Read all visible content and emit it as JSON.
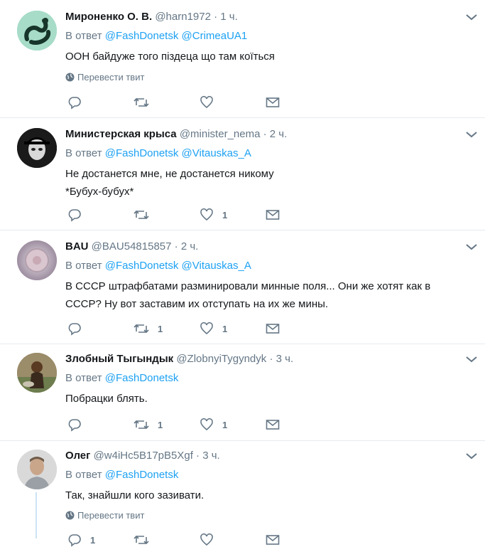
{
  "ui": {
    "reply_prefix": "В ответ",
    "translate_label": "Перевести твит"
  },
  "tweets": [
    {
      "name": "Мироненко О. В.",
      "handle": "@harn1972",
      "time": "1 ч.",
      "mentions": [
        "@FashDonetsk",
        "@CrimeaUA1"
      ],
      "lines": [
        "ООН байдуже того піздеца що там коїться"
      ],
      "replies": "",
      "retweets": "",
      "likes": ""
    },
    {
      "name": "Министерская крыса",
      "handle": "@minister_nema",
      "time": "2 ч.",
      "mentions": [
        "@FashDonetsk",
        "@Vitauskas_A"
      ],
      "lines": [
        "Не достанется мне, не достанется никому",
        "*Бубух-бубух*"
      ],
      "replies": "",
      "retweets": "",
      "likes": "1"
    },
    {
      "name": "BAU",
      "handle": "@BAU54815857",
      "time": "2 ч.",
      "mentions": [
        "@FashDonetsk",
        "@Vitauskas_A"
      ],
      "lines": [
        "В СССР штрафбатами разминировали минные поля... Они же хотят как в",
        "СССР? Ну вот заставим их отступать на их же мины."
      ],
      "replies": "",
      "retweets": "1",
      "likes": "1"
    },
    {
      "name": "Злобный Тыгындык",
      "handle": "@ZlobnyiTygyndyk",
      "time": "3 ч.",
      "mentions": [
        "@FashDonetsk"
      ],
      "lines": [
        "Побрацки блять."
      ],
      "replies": "",
      "retweets": "1",
      "likes": "1"
    },
    {
      "name": "Олег",
      "handle": "@w4iHc5B17pB5Xgf",
      "time": "3 ч.",
      "mentions": [
        "@FashDonetsk"
      ],
      "lines": [
        "Так, знайшли кого зазивати."
      ],
      "replies": "1",
      "retweets": "",
      "likes": ""
    }
  ],
  "colors": {
    "link": "#1da1f2",
    "muted": "#657786",
    "text": "#14171a",
    "divider": "#e6ecf0"
  }
}
